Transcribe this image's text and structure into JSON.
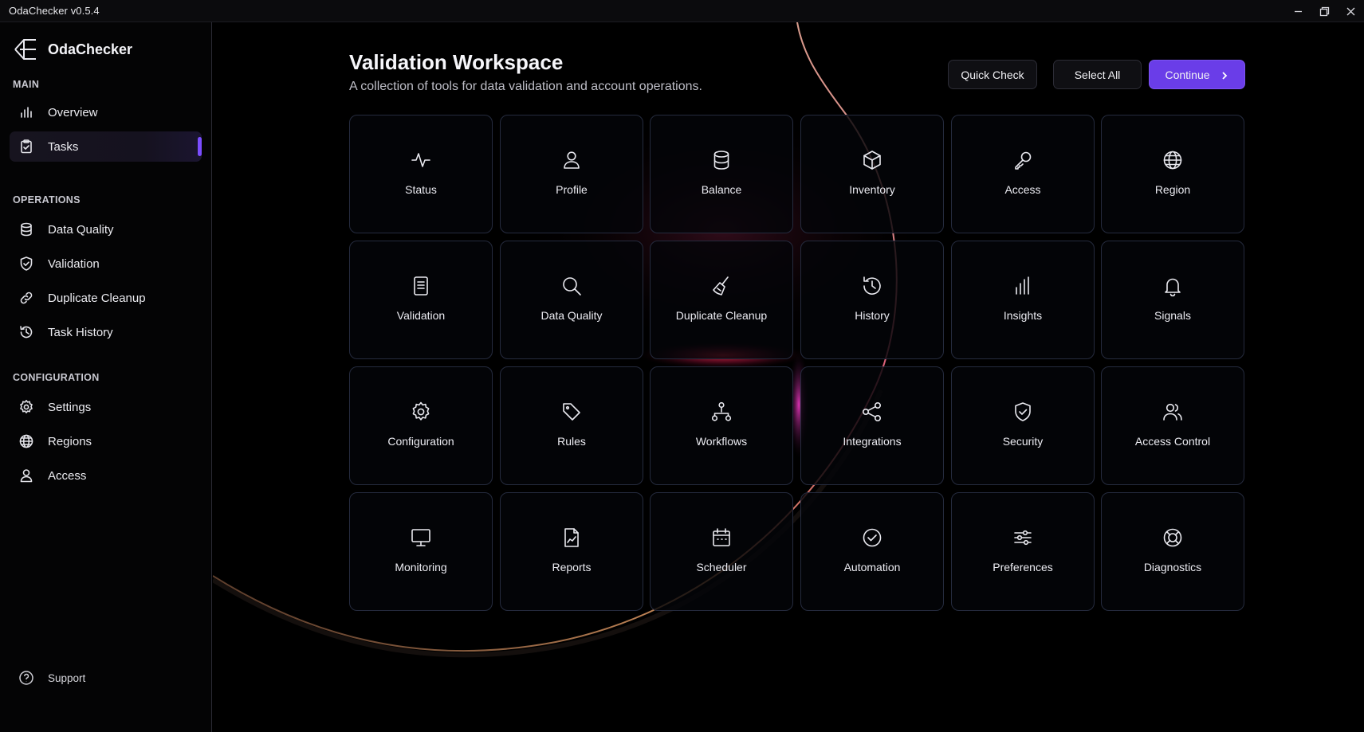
{
  "window": {
    "title": "OdaChecker v0.5.4",
    "controls": [
      "minimize-icon",
      "restore-icon",
      "close-icon"
    ]
  },
  "sidebar": {
    "brand": "OdaChecker",
    "sections": [
      {
        "label": "MAIN",
        "items": [
          {
            "label": "Overview",
            "icon": "bar-chart-icon"
          },
          {
            "label": "Tasks",
            "icon": "clipboard-check-icon",
            "active": true
          }
        ]
      },
      {
        "label": "OPERATIONS",
        "items": [
          {
            "label": "Data Quality",
            "icon": "database-icon"
          },
          {
            "label": "Validation",
            "icon": "shield-check-icon"
          },
          {
            "label": "Duplicate Cleanup",
            "icon": "link-icon"
          },
          {
            "label": "Task History",
            "icon": "history-icon"
          }
        ]
      },
      {
        "label": "CONFIGURATION",
        "items": [
          {
            "label": "Settings",
            "icon": "gear-icon"
          },
          {
            "label": "Regions",
            "icon": "globe-icon"
          },
          {
            "label": "Access",
            "icon": "user-icon"
          }
        ]
      }
    ],
    "support": "Support"
  },
  "header": {
    "title": "Validation Workspace",
    "subtitle": "A collection of tools for data validation and account operations.",
    "quick_check": "Quick Check",
    "select_all": "Select All",
    "continue": "Continue"
  },
  "tiles": [
    {
      "label": "Status",
      "icon": "activity-icon"
    },
    {
      "label": "Profile",
      "icon": "user-icon"
    },
    {
      "label": "Balance",
      "icon": "database-icon"
    },
    {
      "label": "Inventory",
      "icon": "cube-icon"
    },
    {
      "label": "Access",
      "icon": "key-icon"
    },
    {
      "label": "Region",
      "icon": "globe-icon"
    },
    {
      "label": "Validation",
      "icon": "document-icon"
    },
    {
      "label": "Data Quality",
      "icon": "search-icon"
    },
    {
      "label": "Duplicate Cleanup",
      "icon": "broom-icon"
    },
    {
      "label": "History",
      "icon": "history-icon"
    },
    {
      "label": "Insights",
      "icon": "bar-chart-icon"
    },
    {
      "label": "Signals",
      "icon": "bell-icon"
    },
    {
      "label": "Configuration",
      "icon": "gear-icon"
    },
    {
      "label": "Rules",
      "icon": "tag-icon"
    },
    {
      "label": "Workflows",
      "icon": "workflow-icon"
    },
    {
      "label": "Integrations",
      "icon": "share-icon"
    },
    {
      "label": "Security",
      "icon": "shield-check-icon"
    },
    {
      "label": "Access Control",
      "icon": "users-icon"
    },
    {
      "label": "Monitoring",
      "icon": "monitor-icon"
    },
    {
      "label": "Reports",
      "icon": "report-icon"
    },
    {
      "label": "Scheduler",
      "icon": "calendar-icon"
    },
    {
      "label": "Automation",
      "icon": "check-circle-icon"
    },
    {
      "label": "Preferences",
      "icon": "sliders-icon"
    },
    {
      "label": "Diagnostics",
      "icon": "lifebuoy-icon"
    }
  ],
  "colors": {
    "accent": "#6a3de8",
    "active_bar": "#7b4dff",
    "tile_border": "#252b3e",
    "background": "#000000"
  }
}
